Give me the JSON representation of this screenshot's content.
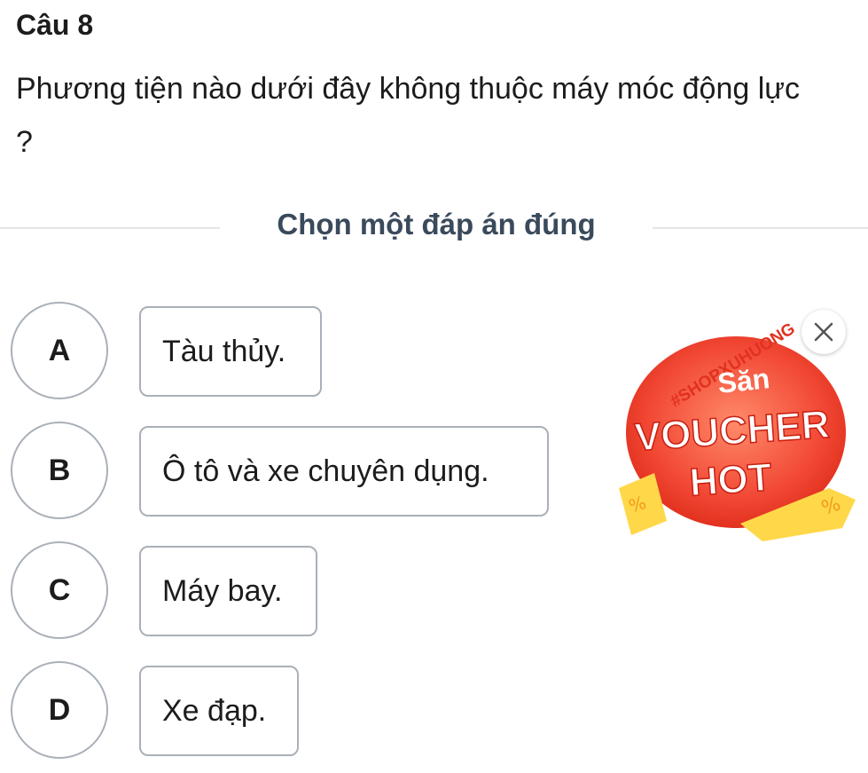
{
  "question": {
    "number": "Câu 8",
    "text": "Phương tiện nào dưới đây không thuộc máy móc động lực ?"
  },
  "instruction": "Chọn một đáp án đúng",
  "options": [
    {
      "letter": "A",
      "text": "Tàu thủy."
    },
    {
      "letter": "B",
      "text": "Ô tô và xe chuyên dụng."
    },
    {
      "letter": "C",
      "text": "Máy bay."
    },
    {
      "letter": "D",
      "text": "Xe đạp."
    }
  ],
  "promo": {
    "hashtag": "#SHOPXUHUONG",
    "line1": "Săn",
    "line2": "VOUCHER",
    "line3": "HOT",
    "close_icon": "close-icon",
    "colors": {
      "red": "#f04a3a",
      "yellow": "#ffd84a",
      "white": "#ffffff"
    }
  }
}
